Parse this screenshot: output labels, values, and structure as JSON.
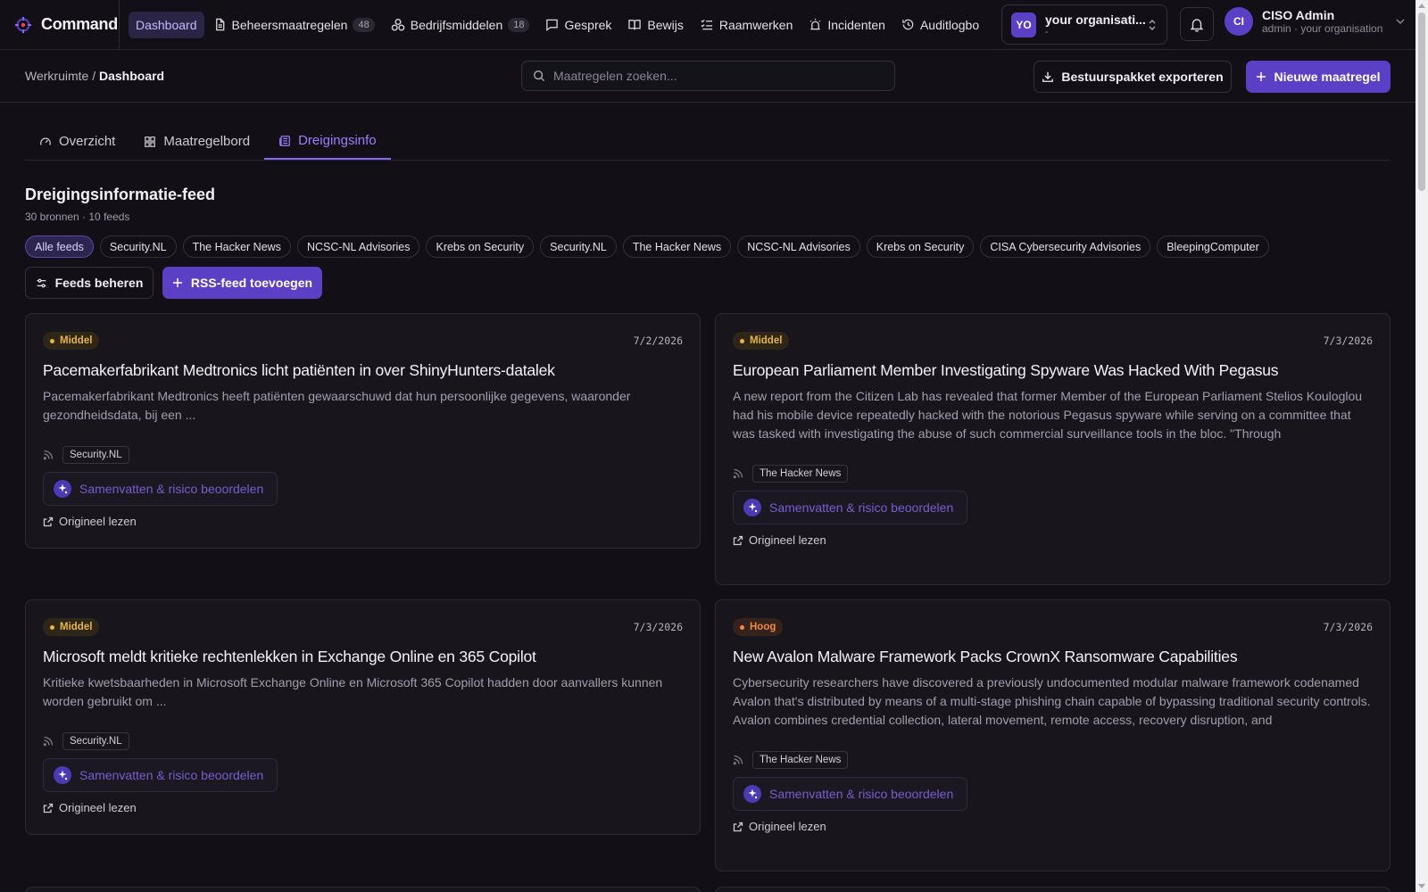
{
  "app": {
    "name": "Command"
  },
  "nav": [
    {
      "label": "Dashboard",
      "icon": "none",
      "active": true
    },
    {
      "label": "Beheersmaatregelen",
      "icon": "file-icon",
      "count": "48"
    },
    {
      "label": "Bedrijfsmiddelen",
      "icon": "assets-icon",
      "count": "18"
    },
    {
      "label": "Gesprek",
      "icon": "chat-icon"
    },
    {
      "label": "Bewijs",
      "icon": "book-icon"
    },
    {
      "label": "Raamwerken",
      "icon": "checklist-icon"
    },
    {
      "label": "Incidenten",
      "icon": "siren-icon"
    },
    {
      "label": "Auditlogbo",
      "icon": "history-icon"
    }
  ],
  "org": {
    "avatar": "YO",
    "name": "your organisati...",
    "sub": "-"
  },
  "user": {
    "avatar": "CI",
    "name": "CISO Admin",
    "sub": "admin · your organisation"
  },
  "breadcrumb": {
    "root": "Werkruimte",
    "sep": " / ",
    "current": "Dashboard"
  },
  "search": {
    "placeholder": "Maatregelen zoeken..."
  },
  "actions": {
    "export": "Bestuurspakket exporteren",
    "new": "Nieuwe maatregel"
  },
  "tabs": [
    {
      "label": "Overzicht",
      "icon": "gauge-icon"
    },
    {
      "label": "Maatregelbord",
      "icon": "grid-icon"
    },
    {
      "label": "Dreigingsinfo",
      "icon": "newspaper-icon",
      "active": true
    }
  ],
  "feed": {
    "title": "Dreigingsinformatie-feed",
    "subtitle": "30 bronnen · 10 feeds",
    "chips": [
      "Alle feeds",
      "Security.NL",
      "The Hacker News",
      "NCSC-NL Advisories",
      "Krebs on Security",
      "Security.NL",
      "The Hacker News",
      "NCSC-NL Advisories",
      "Krebs on Security",
      "CISA Cybersecurity Advisories",
      "BleepingComputer"
    ],
    "manage": "Feeds beheren",
    "add": "RSS-feed toevoegen"
  },
  "card_labels": {
    "ai": "Samenvatten & risico beoordelen",
    "original": "Origineel lezen"
  },
  "cards": [
    {
      "severity": "Middel",
      "date": "7/2/2026",
      "title": "Pacemakerfabrikant Medtronics licht patiënten in over ShinyHunters-datalek",
      "desc": "Pacemakerfabrikant Medtronics heeft patiënten gewaarschuwd dat hun persoonlijke gegevens, waaronder gezondheidsdata, bij een ...",
      "source": "Security.NL"
    },
    {
      "severity": "Middel",
      "date": "7/3/2026",
      "title": "European Parliament Member Investigating Spyware Was Hacked With Pegasus",
      "desc": "A new report from the Citizen Lab has revealed that former Member of the European Parliament Stelios Kouloglou had his mobile device repeatedly hacked with the notorious Pegasus spyware while serving on a committee that was tasked with investigating the abuse of such commercial surveillance tools in the bloc. \"Through",
      "source": "The Hacker News"
    },
    {
      "severity": "Middel",
      "date": "7/3/2026",
      "title": "Microsoft meldt kritieke rechtenlekken in Exchange Online en 365 Copilot",
      "desc": "Kritieke kwetsbaarheden in Microsoft Exchange Online en Microsoft 365 Copilot hadden door aanvallers kunnen worden gebruikt om ...",
      "source": "Security.NL"
    },
    {
      "severity": "Hoog",
      "date": "7/3/2026",
      "title": "New Avalon Malware Framework Packs CrownX Ransomware Capabilities",
      "desc": "Cybersecurity researchers have discovered a previously undocumented modular malware framework codenamed Avalon that's distributed by means of a multi-stage phishing chain capable of bypassing traditional security controls. Avalon combines credential collection, lateral movement, remote access, recovery disruption, and",
      "source": "The Hacker News"
    }
  ],
  "colors": {
    "accent": "#5b3fc4",
    "tab_active": "#9d7dff",
    "severity_mid": "#e8b443",
    "severity_high": "#f08a3c",
    "background": "#121016"
  }
}
